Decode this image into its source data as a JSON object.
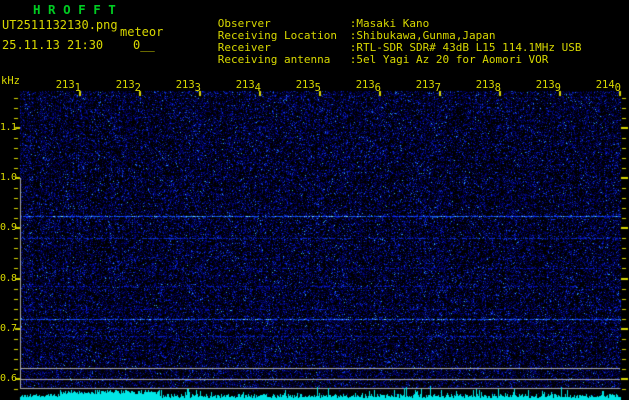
{
  "header": {
    "title": "H R O F F T",
    "filename": "UT2511132130.png",
    "station": "meteor",
    "datetime": "25.11.13 21:30",
    "count": "0__",
    "info": [
      {
        "label": "Observer",
        "value": ":Masaki Kano"
      },
      {
        "label": "Receiving Location",
        "value": ":Shibukawa,Gunma,Japan"
      },
      {
        "label": "Receiver",
        "value": ":RTL-SDR SDR# 43dB L15 114.1MHz USB"
      },
      {
        "label": "Receiving antenna",
        "value": ":5el Yagi Az 20 for Aomori VOR"
      }
    ]
  },
  "chart_data": {
    "type": "heatmap",
    "subtype": "radio-spectrogram",
    "title": "HROFFT 10-minute meteor echo spectrogram",
    "ylabel": "kHz",
    "x_ticks": [
      "2131",
      "2132",
      "2133",
      "2134",
      "2135",
      "2136",
      "2137",
      "2138",
      "2139",
      "2140"
    ],
    "xlim": [
      "21:30",
      "21:40"
    ],
    "x_tick_interval_min": 1,
    "y_ticks": [
      "1.1",
      "1.0",
      "0.9",
      "0.8",
      "0.7",
      "0.6"
    ],
    "ylim_khz": [
      0.58,
      1.17
    ],
    "y_minor_step_khz": 0.02,
    "grid": "off",
    "legend": "none",
    "carrier_lines_khz": [
      {
        "khz": 0.925,
        "intensity": 0.95
      },
      {
        "khz": 0.88,
        "intensity": 0.5
      },
      {
        "khz": 0.82,
        "intensity": 0.18
      },
      {
        "khz": 0.785,
        "intensity": 0.28
      },
      {
        "khz": 0.74,
        "intensity": 0.15
      },
      {
        "khz": 0.72,
        "intensity": 0.9
      },
      {
        "khz": 0.7,
        "intensity": 0.15
      },
      {
        "khz": 0.685,
        "intensity": 0.32
      }
    ],
    "marker_lines_khz": [
      0.622,
      0.6,
      0.582
    ],
    "counting_band_left_border_khz": [
      1.0,
      0.582
    ],
    "level_meter": {
      "position": "bottom-strip",
      "style": "random-cyan-spikes"
    }
  },
  "colors": {
    "background": "#000000",
    "text_yellow": "#d8d800",
    "title_green": "#00cc22",
    "frame_gray": "#a8a8a8",
    "noise_blue": "#0000aa",
    "signal_bright": "#3355ff",
    "signal_peak_cyan": "#66ccff",
    "level_meter_cyan": "#00e6e6"
  }
}
